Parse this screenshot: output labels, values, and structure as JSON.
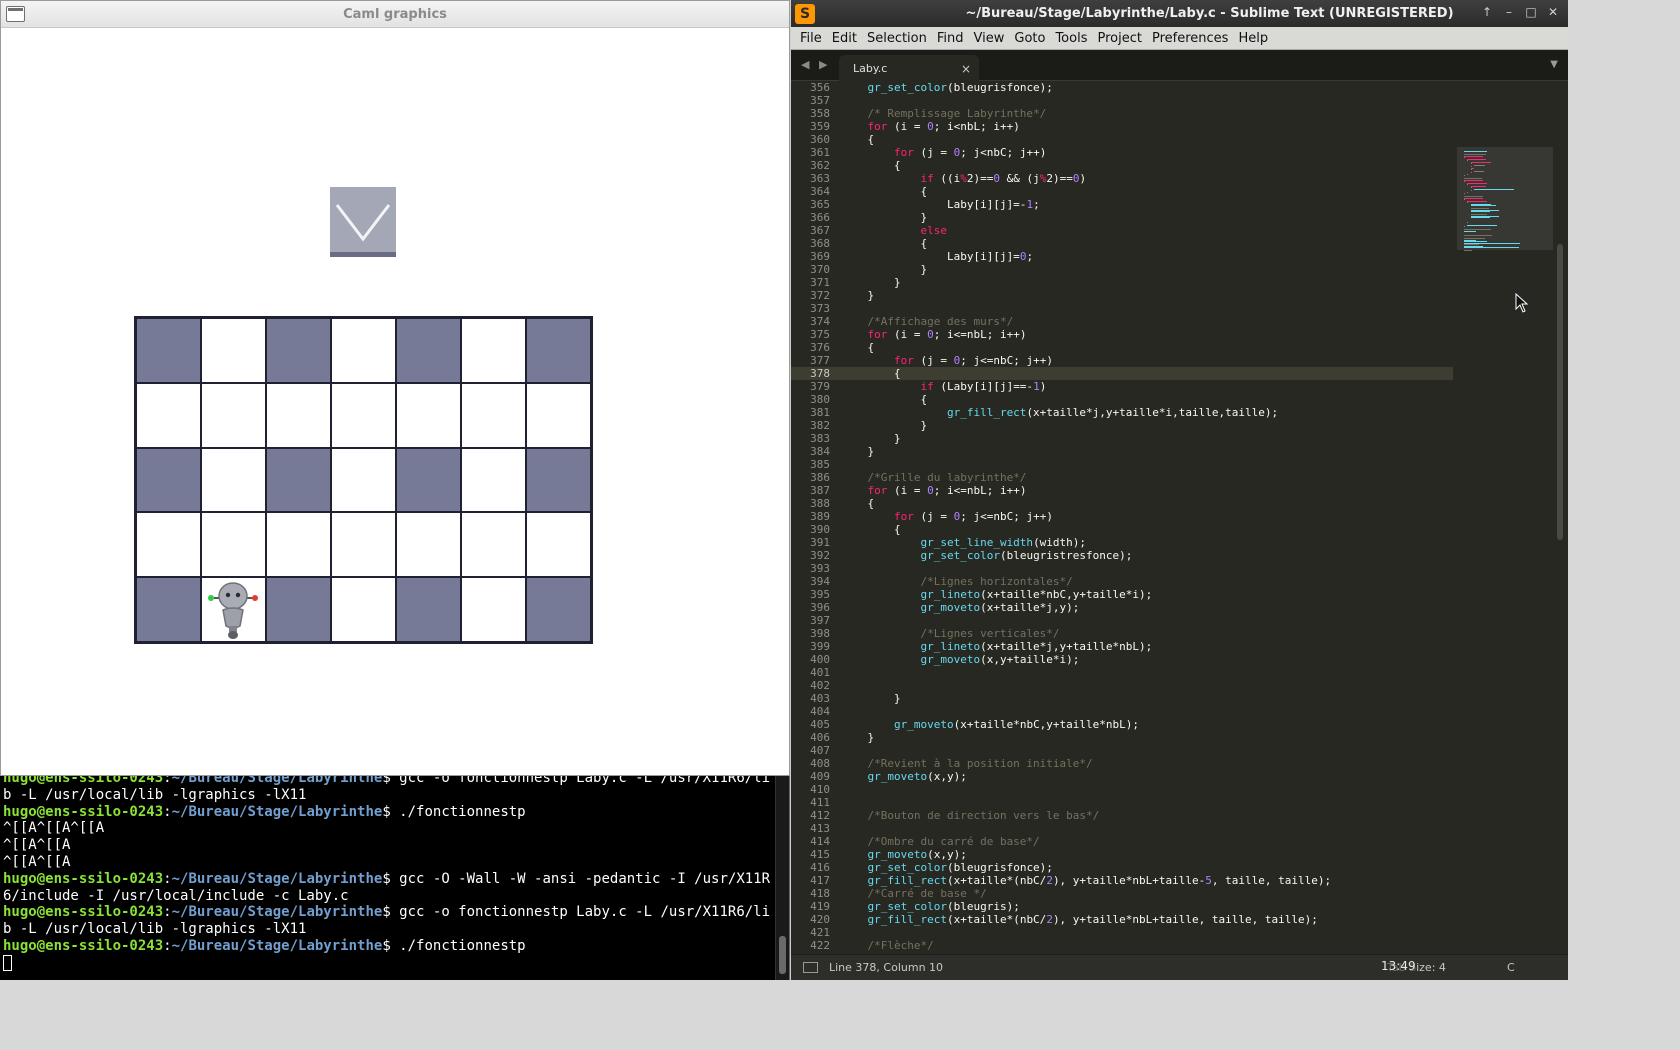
{
  "caml_window": {
    "title": "Caml graphics",
    "maze": {
      "rows": 5,
      "cols": 7,
      "cells": [
        [
          1,
          0,
          1,
          0,
          1,
          0,
          1
        ],
        [
          0,
          0,
          0,
          0,
          0,
          0,
          0
        ],
        [
          1,
          0,
          1,
          0,
          1,
          0,
          1
        ],
        [
          0,
          0,
          0,
          0,
          0,
          0,
          0
        ],
        [
          1,
          0,
          1,
          0,
          1,
          0,
          1
        ]
      ],
      "robot_cell": [
        4,
        1
      ]
    },
    "colors": {
      "wall": "#777a96",
      "grid": "#1f2133",
      "button": "#a3a7b6",
      "button_shadow": "#6b6b86"
    }
  },
  "terminal": {
    "lines": [
      [
        {
          "c": "user",
          "t": "hugo@ens-ssilo-0243"
        },
        {
          "c": "plain",
          "t": ":"
        },
        {
          "c": "path",
          "t": "~/Bureau/Stage/Labyrinthe"
        },
        {
          "c": "plain",
          "t": "$ gcc -o fonctionnestp Laby.c -L /usr/X11R6/li"
        }
      ],
      [
        {
          "c": "plain",
          "t": "b -L /usr/local/lib -lgraphics -lX11"
        }
      ],
      [
        {
          "c": "user",
          "t": "hugo@ens-ssilo-0243"
        },
        {
          "c": "plain",
          "t": ":"
        },
        {
          "c": "path",
          "t": "~/Bureau/Stage/Labyrinthe"
        },
        {
          "c": "plain",
          "t": "$ ./fonctionnestp"
        }
      ],
      [
        {
          "c": "plain",
          "t": "^[[A^[[A^[[A"
        }
      ],
      [
        {
          "c": "plain",
          "t": "^[[A^[[A"
        }
      ],
      [
        {
          "c": "plain",
          "t": "^[[A^[[A"
        }
      ],
      [
        {
          "c": "user",
          "t": "hugo@ens-ssilo-0243"
        },
        {
          "c": "plain",
          "t": ":"
        },
        {
          "c": "path",
          "t": "~/Bureau/Stage/Labyrinthe"
        },
        {
          "c": "plain",
          "t": "$ gcc -O -Wall -W -ansi -pedantic -I /usr/X11R"
        }
      ],
      [
        {
          "c": "plain",
          "t": "6/include -I /usr/local/include -c Laby.c"
        }
      ],
      [
        {
          "c": "user",
          "t": "hugo@ens-ssilo-0243"
        },
        {
          "c": "plain",
          "t": ":"
        },
        {
          "c": "path",
          "t": "~/Bureau/Stage/Labyrinthe"
        },
        {
          "c": "plain",
          "t": "$ gcc -o fonctionnestp Laby.c -L /usr/X11R6/li"
        }
      ],
      [
        {
          "c": "plain",
          "t": "b -L /usr/local/lib -lgraphics -lX11"
        }
      ],
      [
        {
          "c": "user",
          "t": "hugo@ens-ssilo-0243"
        },
        {
          "c": "plain",
          "t": ":"
        },
        {
          "c": "path",
          "t": "~/Bureau/Stage/Labyrinthe"
        },
        {
          "c": "plain",
          "t": "$ ./fonctionnestp"
        }
      ],
      [
        {
          "c": "cursor",
          "t": ""
        }
      ]
    ]
  },
  "sublime": {
    "logo": "S",
    "title": "~/Bureau/Stage/Labyrinthe/Laby.c - Sublime Text (UNREGISTERED)",
    "window_controls": [
      "↑",
      "–",
      "□",
      "✕"
    ],
    "menu": [
      "File",
      "Edit",
      "Selection",
      "Find",
      "View",
      "Goto",
      "Tools",
      "Project",
      "Preferences",
      "Help"
    ],
    "nav_arrows": "◀ ▶",
    "tab": {
      "label": "Laby.c",
      "close": "×"
    },
    "tab_dropdown": "▼",
    "current_line": 378,
    "first_line": 356,
    "code": [
      [
        [
          4,
          "gr_set_color",
          "fn"
        ],
        [
          0,
          "(bleugrisfonce);",
          ""
        ]
      ],
      [],
      [
        [
          4,
          "/* Remplissage Labyrinthe*/",
          "com"
        ]
      ],
      [
        [
          4,
          "for",
          "kw"
        ],
        [
          0,
          " (i = ",
          ""
        ],
        [
          0,
          "0",
          "num"
        ],
        [
          0,
          "; i<nbL; i++)",
          ""
        ]
      ],
      [
        [
          4,
          "{",
          ""
        ]
      ],
      [
        [
          8,
          "for",
          "kw"
        ],
        [
          0,
          " (j = ",
          ""
        ],
        [
          0,
          "0",
          "num"
        ],
        [
          0,
          "; j<nbC; j++)",
          ""
        ]
      ],
      [
        [
          8,
          "{",
          ""
        ]
      ],
      [
        [
          12,
          "if",
          "kw"
        ],
        [
          0,
          " ((i",
          ""
        ],
        [
          0,
          "%",
          "op"
        ],
        [
          0,
          "2",
          ""
        ],
        [
          0,
          ")==",
          ""
        ],
        [
          0,
          "0",
          "num"
        ],
        [
          0,
          " && (j",
          ""
        ],
        [
          0,
          "%",
          "op"
        ],
        [
          0,
          "2)==",
          ""
        ],
        [
          0,
          "0",
          "num"
        ],
        [
          0,
          ")",
          ""
        ]
      ],
      [
        [
          12,
          "{",
          ""
        ]
      ],
      [
        [
          16,
          "Laby[i][j]=-",
          ""
        ],
        [
          0,
          "1",
          "num"
        ],
        [
          0,
          ";",
          ""
        ]
      ],
      [
        [
          12,
          "}",
          ""
        ]
      ],
      [
        [
          12,
          "else",
          "kw"
        ]
      ],
      [
        [
          12,
          "{",
          ""
        ]
      ],
      [
        [
          16,
          "Laby[i][j]=",
          ""
        ],
        [
          0,
          "0",
          "num"
        ],
        [
          0,
          ";",
          ""
        ]
      ],
      [
        [
          12,
          "}",
          ""
        ]
      ],
      [
        [
          8,
          "}",
          ""
        ]
      ],
      [
        [
          4,
          "}",
          ""
        ]
      ],
      [],
      [
        [
          4,
          "/*Affichage des murs*/",
          "com"
        ]
      ],
      [
        [
          4,
          "for",
          "kw"
        ],
        [
          0,
          " (i = ",
          ""
        ],
        [
          0,
          "0",
          "num"
        ],
        [
          0,
          "; i<=nbL; i++)",
          ""
        ]
      ],
      [
        [
          4,
          "{",
          ""
        ]
      ],
      [
        [
          8,
          "for",
          "kw"
        ],
        [
          0,
          " (j = ",
          ""
        ],
        [
          0,
          "0",
          "num"
        ],
        [
          0,
          "; j<=nbC; j++)",
          ""
        ]
      ],
      [
        [
          8,
          "{",
          ""
        ]
      ],
      [
        [
          12,
          "if",
          "kw"
        ],
        [
          0,
          " (Laby[i][j]==-",
          ""
        ],
        [
          0,
          "1",
          "num"
        ],
        [
          0,
          ")",
          ""
        ]
      ],
      [
        [
          12,
          "{",
          ""
        ]
      ],
      [
        [
          16,
          "gr_fill_rect",
          "fn"
        ],
        [
          0,
          "(x+taille*j,y+taille*i,taille,taille);",
          ""
        ]
      ],
      [
        [
          12,
          "}",
          ""
        ]
      ],
      [
        [
          8,
          "}",
          ""
        ]
      ],
      [
        [
          4,
          "}",
          ""
        ]
      ],
      [],
      [
        [
          4,
          "/*Grille du labyrinthe*/",
          "com"
        ]
      ],
      [
        [
          4,
          "for",
          "kw"
        ],
        [
          0,
          " (i = ",
          ""
        ],
        [
          0,
          "0",
          "num"
        ],
        [
          0,
          "; i<=nbL; i++)",
          ""
        ]
      ],
      [
        [
          4,
          "{",
          ""
        ]
      ],
      [
        [
          8,
          "for",
          "kw"
        ],
        [
          0,
          " (j = ",
          ""
        ],
        [
          0,
          "0",
          "num"
        ],
        [
          0,
          "; j<=nbC; j++)",
          ""
        ]
      ],
      [
        [
          8,
          "{",
          ""
        ]
      ],
      [
        [
          12,
          "gr_set_line_width",
          "fn"
        ],
        [
          0,
          "(width);",
          ""
        ]
      ],
      [
        [
          12,
          "gr_set_color",
          "fn"
        ],
        [
          0,
          "(bleugristresfonce);",
          ""
        ]
      ],
      [],
      [
        [
          12,
          "/*Lignes horizontales*/",
          "com"
        ]
      ],
      [
        [
          12,
          "gr_lineto",
          "fn"
        ],
        [
          0,
          "(x+taille*nbC,y+taille*i);",
          ""
        ]
      ],
      [
        [
          12,
          "gr_moveto",
          "fn"
        ],
        [
          0,
          "(x+taille*j,y);",
          ""
        ]
      ],
      [],
      [
        [
          12,
          "/*Lignes verticales*/",
          "com"
        ]
      ],
      [
        [
          12,
          "gr_lineto",
          "fn"
        ],
        [
          0,
          "(x+taille*j,y+taille*nbL);",
          ""
        ]
      ],
      [
        [
          12,
          "gr_moveto",
          "fn"
        ],
        [
          0,
          "(x,y+taille*i);",
          ""
        ]
      ],
      [],
      [],
      [
        [
          8,
          "}",
          ""
        ]
      ],
      [],
      [
        [
          8,
          "gr_moveto",
          "fn"
        ],
        [
          0,
          "(x+taille*nbC,y+taille*nbL);",
          ""
        ]
      ],
      [
        [
          4,
          "}",
          ""
        ]
      ],
      [],
      [
        [
          4,
          "/*Revient à la position initiale*/",
          "com"
        ]
      ],
      [
        [
          4,
          "gr_moveto",
          "fn"
        ],
        [
          0,
          "(x,y);",
          ""
        ]
      ],
      [],
      [],
      [
        [
          4,
          "/*Bouton de direction vers le bas*/",
          "com"
        ]
      ],
      [],
      [
        [
          4,
          "/*Ombre du carré de base*/",
          "com"
        ]
      ],
      [
        [
          4,
          "gr_moveto",
          "fn"
        ],
        [
          0,
          "(x,y);",
          ""
        ]
      ],
      [
        [
          4,
          "gr_set_color",
          "fn"
        ],
        [
          0,
          "(bleugrisfonce);",
          ""
        ]
      ],
      [
        [
          4,
          "gr_fill_rect",
          "fn"
        ],
        [
          0,
          "(x+taille*(nbC/",
          ""
        ],
        [
          0,
          "2",
          "num"
        ],
        [
          0,
          "), y+taille*nbL+taille-",
          ""
        ],
        [
          0,
          "5",
          "num"
        ],
        [
          0,
          ", taille, taille);",
          ""
        ]
      ],
      [
        [
          4,
          "/*Carré de base */",
          "com"
        ]
      ],
      [
        [
          4,
          "gr_set_color",
          "fn"
        ],
        [
          0,
          "(bleugris);",
          ""
        ]
      ],
      [
        [
          4,
          "gr_fill_rect",
          "fn"
        ],
        [
          0,
          "(x+taille*(nbC/",
          ""
        ],
        [
          0,
          "2",
          "num"
        ],
        [
          0,
          "), y+taille*nbL+taille, taille, taille);",
          ""
        ]
      ],
      [],
      [
        [
          4,
          "/*Flèche*/",
          "com"
        ]
      ]
    ],
    "status": {
      "position": "Line 378, Column 10",
      "tab_size": "Tab Size: 4",
      "syntax": "C",
      "clock": "13:49"
    },
    "colors": {
      "background": "#272822",
      "comment": "#75715e",
      "keyword": "#f92672",
      "function": "#66d9ef",
      "number": "#ae81ff"
    }
  }
}
